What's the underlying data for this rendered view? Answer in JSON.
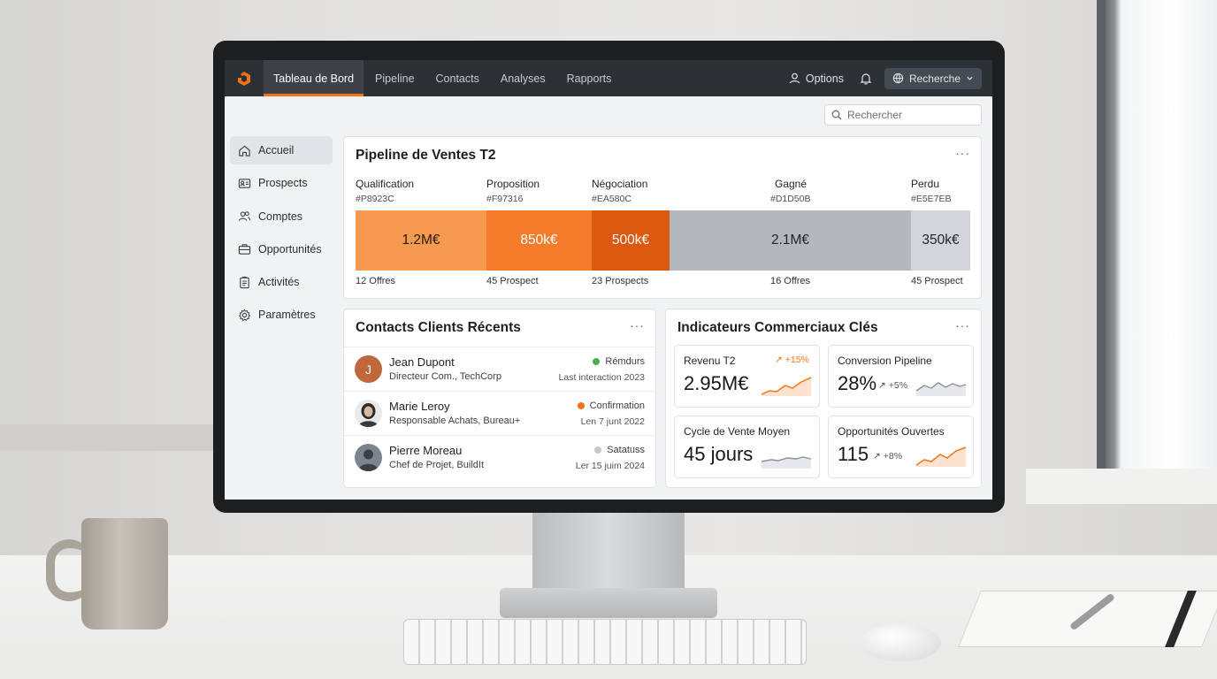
{
  "nav": {
    "items": [
      {
        "label": "Tableau de Bord",
        "active": true
      },
      {
        "label": "Pipeline"
      },
      {
        "label": "Contacts"
      },
      {
        "label": "Analyses"
      },
      {
        "label": "Rapports"
      }
    ],
    "options_label": "Options",
    "search_button_label": "Recherche"
  },
  "search": {
    "placeholder": "Rechercher"
  },
  "sidebar": {
    "items": [
      {
        "label": "Accueil",
        "icon": "home-icon",
        "active": true
      },
      {
        "label": "Prospects",
        "icon": "id-card-icon"
      },
      {
        "label": "Comptes",
        "icon": "users-icon"
      },
      {
        "label": "Opportunités",
        "icon": "briefcase-icon"
      },
      {
        "label": "Activités",
        "icon": "clipboard-icon"
      },
      {
        "label": "Paramètres",
        "icon": "gear-icon"
      }
    ]
  },
  "pipeline": {
    "title": "Pipeline de Ventes T2",
    "stages": [
      {
        "label": "Qualification",
        "hex": "#P8923C",
        "value": "1.2M€",
        "count": "12 Offres",
        "color": "#F59A4E"
      },
      {
        "label": "Proposition",
        "hex": "#F97316",
        "value": "850k€",
        "count": "45 Prospect",
        "color": "#F47C2A"
      },
      {
        "label": "Négociation",
        "hex": "#EA580C",
        "value": "500k€",
        "count": "23 Prospects",
        "color": "#DC5A10"
      },
      {
        "label": "Gagné",
        "hex": "#D1D50B",
        "value": "2.1M€",
        "count": "16 Offres",
        "color": "#B4B8BE"
      },
      {
        "label": "Perdu",
        "hex": "#E5E7EB",
        "value": "350k€",
        "count": "45 Prospect",
        "color": "#D3D5D9"
      }
    ]
  },
  "contacts": {
    "title": "Contacts Clients Récents",
    "rows": [
      {
        "initial": "J",
        "name": "Jean Dupont",
        "role": "Directeur Com., TechCorp",
        "status": "Rémdurs",
        "status_color": "#4CAF50",
        "date": "Last interaction 2023"
      },
      {
        "initial": "",
        "name": "Marie Leroy",
        "role": "Responsable Achats, Bureau+",
        "status": "Confirmation",
        "status_color": "#F97316",
        "date": "Len 7 junt 2022"
      },
      {
        "initial": "",
        "name": "Pierre Moreau",
        "role": "Chef de Projet, BuildIt",
        "status": "Satatuss",
        "status_color": "#C5C8CC",
        "date": "Ler 15 juim 2024"
      }
    ]
  },
  "kpis": {
    "title": "Indicateurs Commerciaux Clés",
    "items": [
      {
        "label": "Revenu T2",
        "value": "2.95M€",
        "delta": "+15%",
        "delta_color": "#F97316"
      },
      {
        "label": "Conversion Pipeline",
        "value": "28%",
        "delta": "+5%",
        "delta_color": "#4e555d"
      },
      {
        "label": "Cycle de Vente Moyen",
        "value": "45 jours",
        "delta": "",
        "delta_color": "#4e555d"
      },
      {
        "label": "Opportunités Ouvertes",
        "value": "115",
        "delta": "+8%",
        "delta_color": "#4e555d"
      }
    ]
  }
}
